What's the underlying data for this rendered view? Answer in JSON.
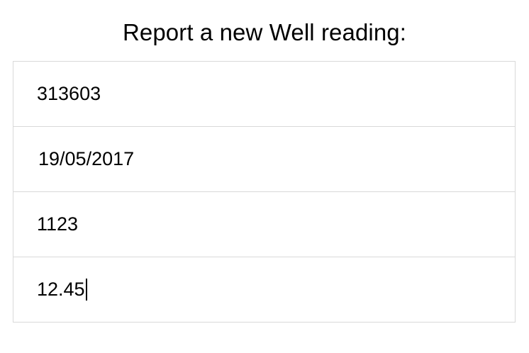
{
  "form": {
    "title": "Report a new Well reading:",
    "fields": [
      {
        "value": "313603"
      },
      {
        "value": "19/05/2017"
      },
      {
        "value": "1123"
      },
      {
        "value": "12.45"
      }
    ]
  }
}
